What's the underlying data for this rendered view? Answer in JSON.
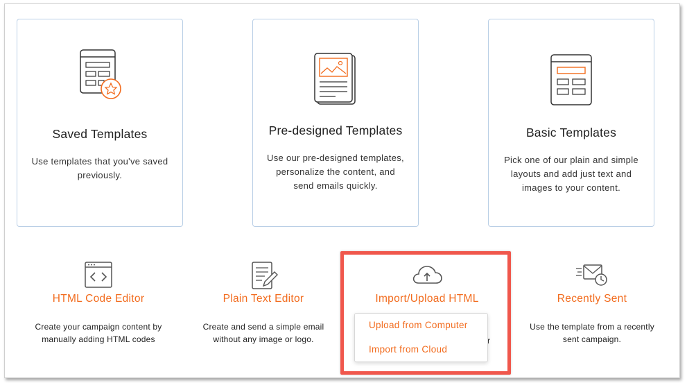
{
  "cards": [
    {
      "title": "Saved Templates",
      "desc": [
        "Use templates that you've saved",
        "previously."
      ],
      "icon": "saved-template-icon"
    },
    {
      "title": "Pre-designed Templates",
      "desc": [
        "Use our pre-designed templates,",
        "personalize the content, and",
        "send emails quickly."
      ],
      "icon": "predesigned-template-icon"
    },
    {
      "title": "Basic Templates",
      "desc": [
        "Pick one of our plain and simple",
        "layouts and add just text and",
        "images to your content."
      ],
      "icon": "basic-template-icon"
    }
  ],
  "options": [
    {
      "title": "HTML Code Editor",
      "desc": [
        "Create your campaign content by",
        "manually adding HTML codes"
      ],
      "icon": "code-window-icon"
    },
    {
      "title": "Plain Text Editor",
      "desc": [
        "Create and send a simple email",
        "without any image or logo."
      ],
      "icon": "text-document-icon"
    },
    {
      "title": "Import/Upload HTML",
      "desc": [],
      "icon": "cloud-upload-icon"
    },
    {
      "title": "Recently Sent",
      "desc": [
        "Use the template from a recently",
        "sent campaign."
      ],
      "icon": "mail-clock-icon"
    }
  ],
  "dropdown": {
    "items": [
      "Upload from Computer",
      "Import from Cloud"
    ]
  },
  "obscured_tail": "r",
  "colors": {
    "accent": "#f26b1d",
    "highlight": "#f0574c",
    "card_border": "#b9cfe6"
  }
}
